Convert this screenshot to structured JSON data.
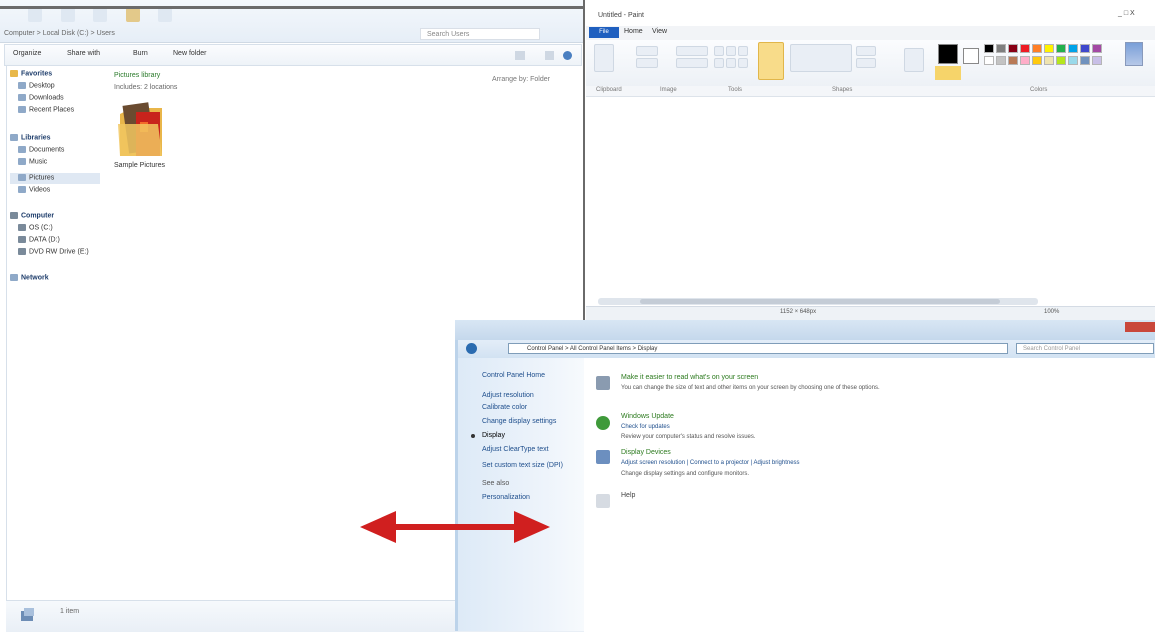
{
  "explorer": {
    "breadcrumb": "Computer > Local Disk (C:) > Users",
    "search_placeholder": "Search Users",
    "toolbar": [
      "Organize",
      "Share with",
      "Burn",
      "New folder"
    ],
    "nav": {
      "favorites_header": "Favorites",
      "favorites": [
        "Desktop",
        "Downloads",
        "Recent Places"
      ],
      "libraries_header": "Libraries",
      "libraries": [
        "Documents",
        "Music",
        "Pictures",
        "Videos"
      ],
      "computer_header": "Computer",
      "drives": [
        "OS (C:)",
        "DATA (D:)",
        "DVD RW Drive (E:)"
      ],
      "network_header": "Network"
    },
    "folder_header": "Pictures library",
    "folder_sub": "Includes: 2 locations",
    "arrange_by": "Arrange by: Folder",
    "folder_name": "Sample Pictures",
    "status_text": "1 item"
  },
  "paint": {
    "title": "Untitled - Paint",
    "window_buttons": "_ □ X",
    "tabs": {
      "file": "File",
      "home": "Home",
      "view": "View"
    },
    "group_labels": [
      "Clipboard",
      "Image",
      "Tools",
      "Shapes",
      "Colors"
    ],
    "status": {
      "position": "",
      "size": "1152 × 648px",
      "zoom": "100%"
    },
    "colors": {
      "color1": "#000000",
      "color2": "#ffffff",
      "palette_row1": [
        "#000000",
        "#7f7f7f",
        "#880015",
        "#ed1c24",
        "#ff7f27",
        "#fff200",
        "#22b14c",
        "#00a2e8",
        "#3f48cc",
        "#a349a4"
      ],
      "palette_row2": [
        "#ffffff",
        "#c3c3c3",
        "#b97a57",
        "#ffaec9",
        "#ffc90e",
        "#efe4b0",
        "#b5e61d",
        "#99d9ea",
        "#7092be",
        "#c8bfe7"
      ]
    }
  },
  "control_panel": {
    "address": "Control Panel > All Control Panel Items > Display",
    "search_placeholder": "Search Control Panel",
    "sidebar": {
      "home": "Control Panel Home",
      "links": [
        "Adjust resolution",
        "Calibrate color",
        "Change display settings",
        "Adjust ClearType text"
      ],
      "current": "Display",
      "extra": [
        "Set custom text size (DPI)",
        "See also"
      ],
      "see_also": "Personalization"
    },
    "items": [
      {
        "title": "Make it easier to read what's on your screen",
        "link": "",
        "desc": "You can change the size of text and other items on your screen by choosing one of these options."
      },
      {
        "title": "Windows Update",
        "link": "Check for updates",
        "desc": "Review your computer's status and resolve issues."
      },
      {
        "title": "Display Devices",
        "link": "Adjust screen resolution | Connect to a projector | Adjust brightness",
        "desc": "Change display settings and configure monitors."
      },
      {
        "title": "Help",
        "link": "",
        "desc": ""
      }
    ]
  },
  "overlay": {
    "arrow_color": "#d01f1f"
  }
}
